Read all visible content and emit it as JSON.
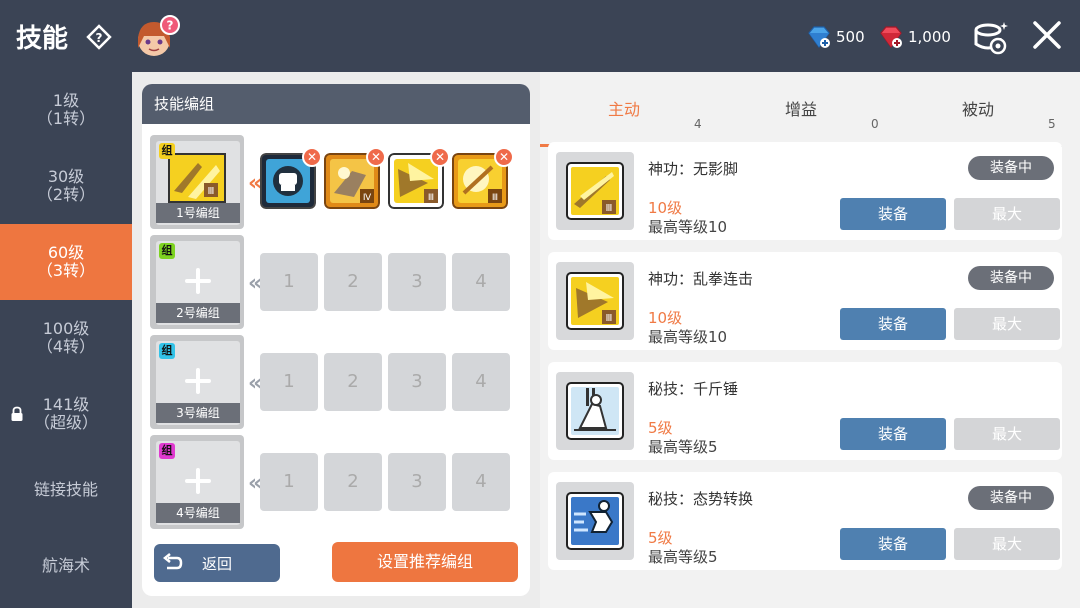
{
  "header": {
    "title": "技能",
    "currency_blue": "500",
    "currency_red": "1,000"
  },
  "sidebar": {
    "items": [
      {
        "line1": "1级",
        "line2": "（1转）"
      },
      {
        "line1": "30级",
        "line2": "（2转）"
      },
      {
        "line1": "60级",
        "line2": "（3转）"
      },
      {
        "line1": "100级",
        "line2": "（4转）"
      },
      {
        "line1": "141级",
        "line2": "（超级）"
      },
      {
        "line1": "链接技能",
        "line2": ""
      },
      {
        "line1": "航海术",
        "line2": ""
      }
    ]
  },
  "left_panel": {
    "title": "技能编组",
    "group_tag": "组",
    "groups": [
      {
        "label": "1号编组"
      },
      {
        "label": "2号编组"
      },
      {
        "label": "3号编组"
      },
      {
        "label": "4号编组"
      }
    ],
    "slot_numbers": [
      "1",
      "2",
      "3",
      "4"
    ],
    "back_label": "返回",
    "recommend_label": "设置推荐编组"
  },
  "tabs": [
    {
      "label": "主动",
      "count": "4"
    },
    {
      "label": "增益",
      "count": "0"
    },
    {
      "label": "被动",
      "count": "5"
    }
  ],
  "skills": [
    {
      "name": "神功：无影脚",
      "level": "10级",
      "max": "最高等级10",
      "equipped": "装备中"
    },
    {
      "name": "神功：乱拳连击",
      "level": "10级",
      "max": "最高等级10",
      "equipped": "装备中"
    },
    {
      "name": "秘技：千斤锤",
      "level": "5级",
      "max": "最高等级5",
      "equipped": ""
    },
    {
      "name": "秘技：态势转换",
      "level": "5级",
      "max": "最高等级5",
      "equipped": "装备中"
    }
  ],
  "skill_buttons": {
    "equip": "装备",
    "max": "最大"
  }
}
